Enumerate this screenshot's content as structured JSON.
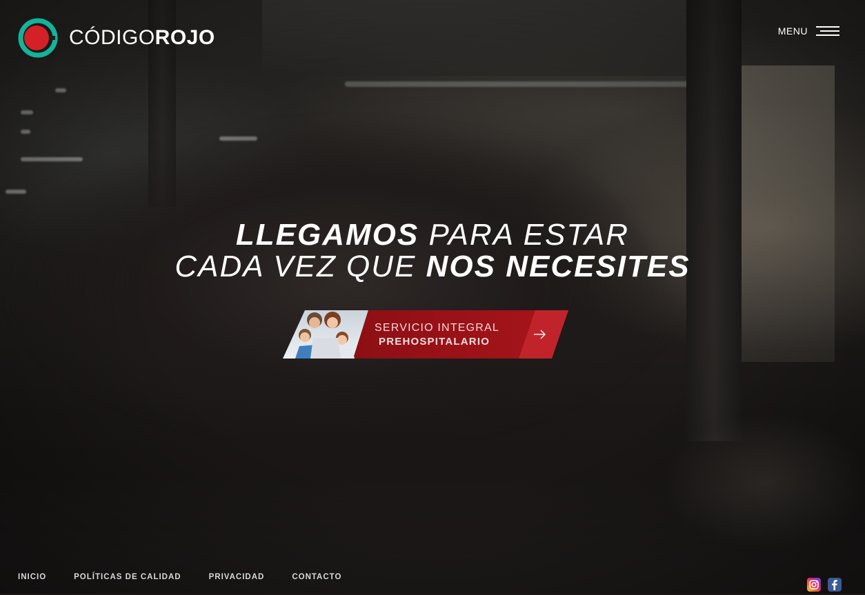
{
  "brand": {
    "name_light": "CÓDIGO",
    "name_bold": "ROJO",
    "ring_color": "#14b39a",
    "dot_color": "#d42027"
  },
  "header": {
    "menu_label": "MENU"
  },
  "hero": {
    "line1_bold": "LLEGAMOS",
    "line1_light": "PARA ESTAR",
    "line2_light": "CADA VEZ QUE",
    "line2_bold": "NOS NECESITES"
  },
  "cta": {
    "line1": "SERVICIO INTEGRAL",
    "line2": "PREHOSPITALARIO",
    "icon": "arrow-right-icon",
    "accent": "#a8151b"
  },
  "footer": {
    "links": [
      "INICIO",
      "POLÍTICAS DE CALIDAD",
      "PRIVACIDAD",
      "CONTACTO"
    ],
    "social": [
      "instagram-icon",
      "facebook-icon"
    ]
  }
}
